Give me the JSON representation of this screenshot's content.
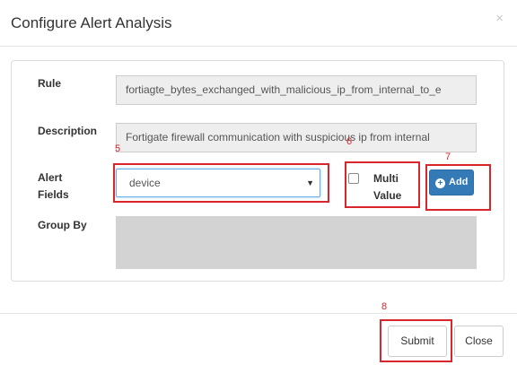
{
  "dialog": {
    "title": "Configure Alert Analysis",
    "close_glyph": "×"
  },
  "form": {
    "rule_label": "Rule",
    "rule_value": "fortiagte_bytes_exchanged_with_malicious_ip_from_internal_to_e",
    "description_label": "Description",
    "description_value": "Fortigate firewall communication with suspicious ip from internal",
    "alert_fields_label_line1": "Alert",
    "alert_fields_label_line2": "Fields",
    "alert_fields_selected": "device",
    "multi_value_line1": "Multi",
    "multi_value_line2": "Value",
    "add_button": "Add",
    "group_by_label": "Group By"
  },
  "footer": {
    "submit": "Submit",
    "close": "Close"
  },
  "annotations": [
    "5",
    "6",
    "7",
    "8"
  ],
  "colors": {
    "annotation": "#d9262c",
    "primary": "#337ab7"
  },
  "icons": {
    "add": "plus-circle-icon",
    "select_caret": "caret-down-icon",
    "close": "close-icon"
  }
}
